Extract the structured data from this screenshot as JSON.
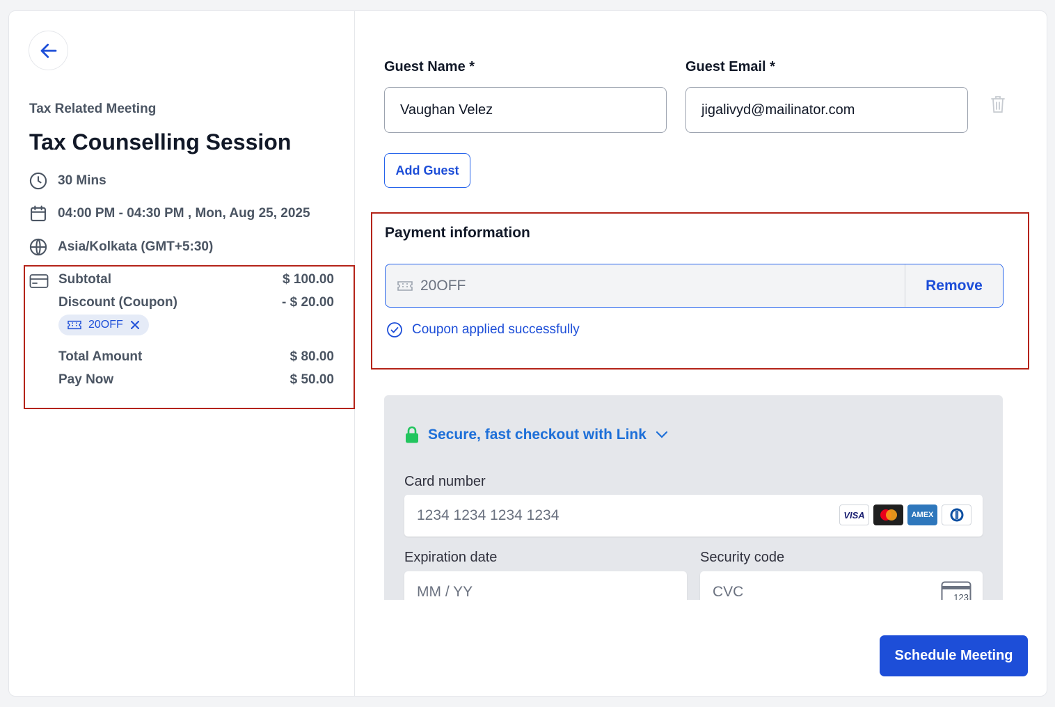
{
  "summary": {
    "meeting_type": "Tax Related Meeting",
    "title": "Tax Counselling Session",
    "duration": "30 Mins",
    "datetime": "04:00 PM - 04:30 PM , Mon, Aug 25, 2025",
    "timezone": "Asia/Kolkata (GMT+5:30)"
  },
  "pricing": {
    "subtotal_label": "Subtotal",
    "subtotal_value": "$ 100.00",
    "discount_label": "Discount (Coupon)",
    "discount_value": "- $ 20.00",
    "coupon_code": "20OFF",
    "total_label": "Total Amount",
    "total_value": "$ 80.00",
    "paynow_label": "Pay Now",
    "paynow_value": "$ 50.00"
  },
  "guest": {
    "name_label": "Guest Name *",
    "name_value": "Vaughan Velez",
    "email_label": "Guest Email *",
    "email_value": "jigalivyd@mailinator.com",
    "add_guest_label": "Add Guest"
  },
  "payment": {
    "title": "Payment information",
    "coupon_value": "20OFF",
    "remove_label": "Remove",
    "applied_message": "Coupon applied successfully"
  },
  "stripe": {
    "link_text": "Secure, fast checkout with Link",
    "card_number_label": "Card number",
    "card_number_placeholder": "1234 1234 1234 1234",
    "expiry_label": "Expiration date",
    "expiry_placeholder": "MM / YY",
    "cvc_label": "Security code",
    "cvc_placeholder": "CVC",
    "cvc_icon_text": "123",
    "brands": [
      "VISA",
      "mastercard",
      "AMEX",
      "Diners"
    ]
  },
  "actions": {
    "schedule_label": "Schedule Meeting"
  },
  "colors": {
    "accent": "#1d4ed8",
    "highlight_border": "#b42318",
    "success_lock": "#22c55e"
  }
}
